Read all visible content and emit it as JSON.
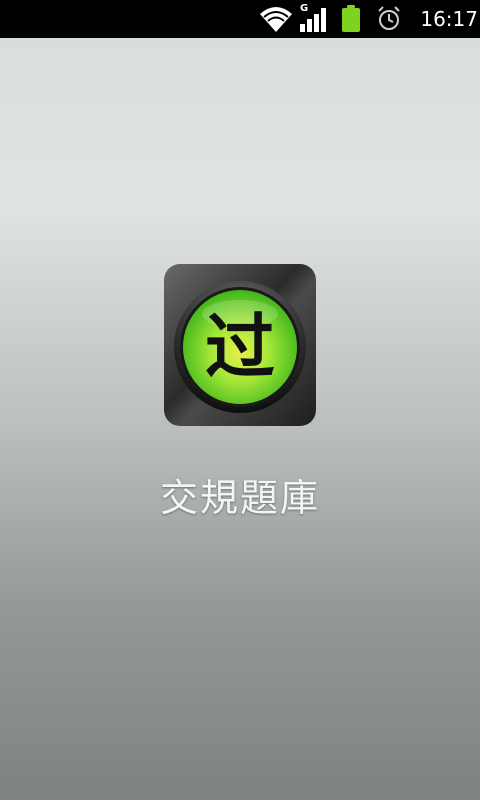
{
  "status_bar": {
    "time": "16:17",
    "network_type": "G",
    "icons": [
      "wifi-icon",
      "signal-icon",
      "battery-icon",
      "alarm-icon"
    ],
    "battery_color": "#7ed321"
  },
  "splash": {
    "app_icon_glyph": "过",
    "app_name": "交規題庫",
    "icon_green": "#5fe01f",
    "icon_yellow": "#e6f04a"
  }
}
